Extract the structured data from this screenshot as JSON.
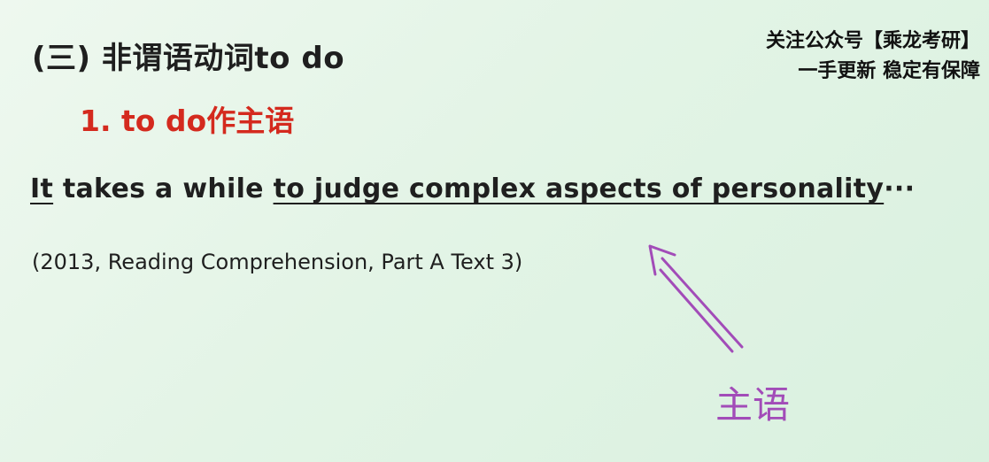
{
  "watermark": {
    "line1": "关注公众号【乘龙考研】",
    "line2": "一手更新 稳定有保障"
  },
  "heading": "(三) 非谓语动词to do",
  "subheading": "1. to do作主语",
  "sentence": {
    "subject_it": "It",
    "middle": " takes a while ",
    "underlined": "to judge complex aspects of personality",
    "ellipsis": "···"
  },
  "citation": "(2013, Reading Comprehension, Part A Text 3)",
  "annotation": {
    "label": "主语",
    "color": "#a24cb8"
  },
  "colors": {
    "background": "#e3f4e6",
    "heading_red": "#d42a1e",
    "annotation_purple": "#a24cb8"
  }
}
